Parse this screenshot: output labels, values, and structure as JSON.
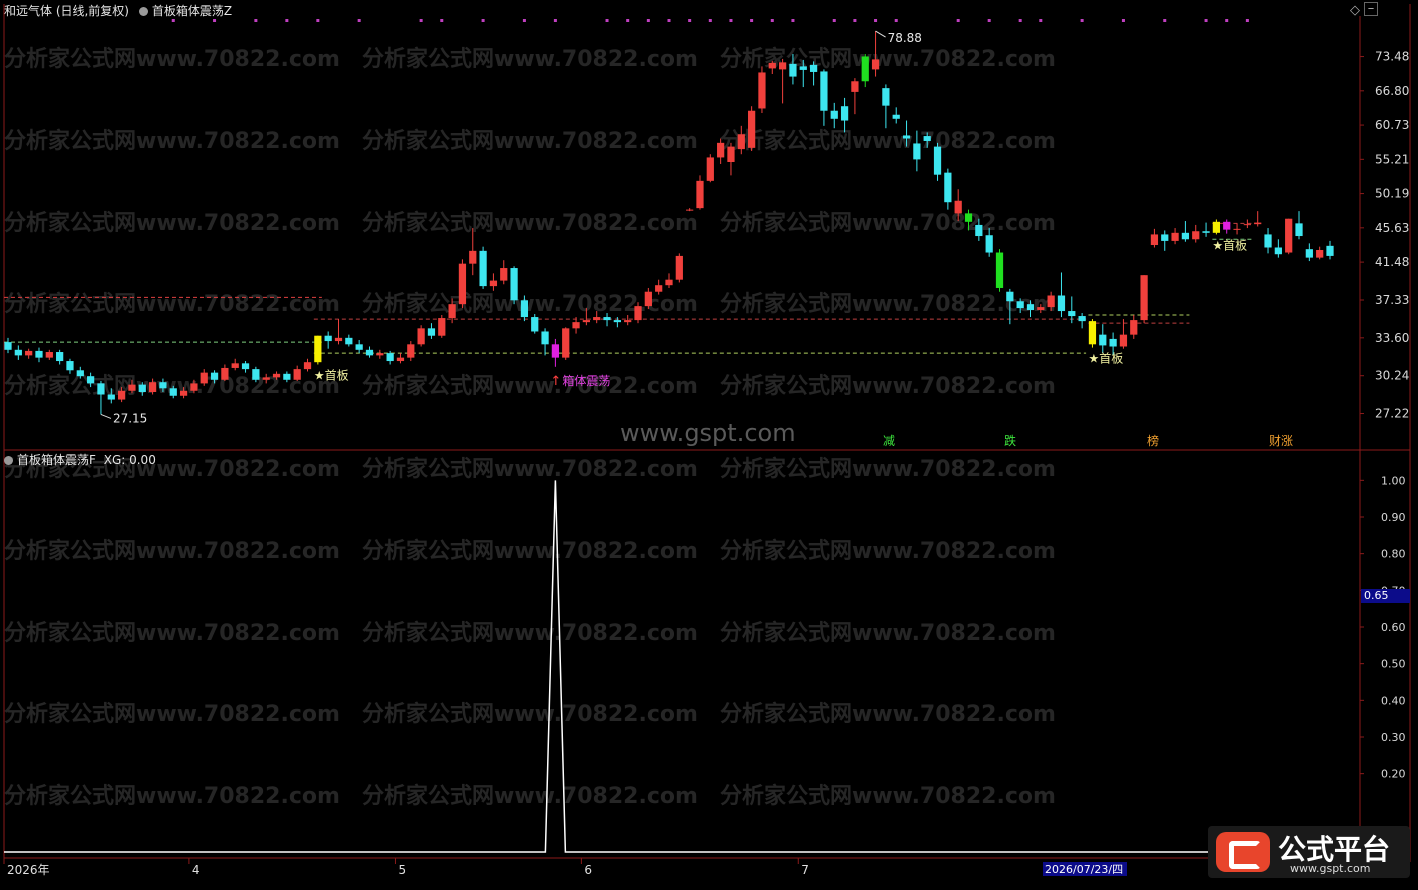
{
  "header": {
    "stock_title": "和远气体 (日线,前复权)",
    "indicator_main": "首板箱体震荡Z",
    "sub_title": "首板箱体震荡F",
    "sub_value": "XG: 0.00"
  },
  "watermarks": {
    "site": "www.gspt.com",
    "repeat": "分析家公式网www.70822.com"
  },
  "logo": {
    "text": "公式平台",
    "url": "www.gspt.com"
  },
  "colors": {
    "up": "#f0403c",
    "down": "#3de6f0",
    "bg": "#000000",
    "axis": "#8b1a1a"
  },
  "chart_data": [
    {
      "type": "candlestick",
      "title": "和远气体 (日线,前复权)",
      "y_axis_ticks": [
        "73.48",
        "66.80",
        "60.73",
        "55.21",
        "50.19",
        "45.63",
        "41.48",
        "37.33",
        "33.60",
        "30.24",
        "27.22"
      ],
      "ylim": [
        25.5,
        80
      ],
      "annotations": {
        "high_label": "78.88",
        "low_label": "27.15",
        "first_board": "★首板",
        "box_shake": "箱体震荡",
        "tags": [
          "减",
          "跌",
          "榜",
          "财涨"
        ]
      },
      "candles": [
        [
          33.2,
          32.5,
          33.6,
          32.2
        ],
        [
          32.5,
          32.0,
          32.9,
          31.6
        ],
        [
          32.0,
          32.4,
          32.6,
          31.7
        ],
        [
          32.4,
          31.8,
          32.7,
          31.4
        ],
        [
          31.8,
          32.3,
          32.5,
          31.6
        ],
        [
          32.3,
          31.5,
          32.5,
          31.2
        ],
        [
          31.5,
          30.7,
          31.7,
          30.4
        ],
        [
          30.7,
          30.2,
          31.0,
          30.0
        ],
        [
          30.2,
          29.6,
          30.5,
          29.3
        ],
        [
          29.6,
          28.7,
          29.8,
          27.15
        ],
        [
          28.7,
          28.3,
          29.2,
          28.0
        ],
        [
          28.3,
          29.0,
          29.3,
          28.1
        ],
        [
          29.0,
          29.5,
          29.9,
          28.8
        ],
        [
          29.5,
          28.9,
          29.7,
          28.6
        ],
        [
          28.9,
          29.7,
          30.0,
          28.7
        ],
        [
          29.7,
          29.2,
          30.0,
          28.9
        ],
        [
          29.2,
          28.6,
          29.4,
          28.4
        ],
        [
          28.6,
          29.0,
          29.3,
          28.4
        ],
        [
          29.0,
          29.6,
          29.9,
          28.8
        ],
        [
          29.6,
          30.5,
          30.8,
          29.4
        ],
        [
          30.5,
          29.9,
          30.7,
          29.6
        ],
        [
          29.9,
          30.9,
          31.2,
          29.8
        ],
        [
          30.9,
          31.3,
          31.7,
          30.7
        ],
        [
          31.3,
          30.8,
          31.5,
          30.5
        ],
        [
          30.8,
          29.9,
          31.0,
          29.7
        ],
        [
          29.9,
          30.1,
          30.4,
          29.6
        ],
        [
          30.1,
          30.4,
          30.6,
          29.9
        ],
        [
          30.4,
          29.9,
          30.6,
          29.7
        ],
        [
          29.9,
          30.8,
          31.1,
          29.8
        ],
        [
          30.8,
          31.4,
          31.7,
          30.6
        ],
        [
          31.4,
          33.8,
          33.8,
          31.2
        ],
        [
          33.8,
          33.3,
          34.2,
          32.6
        ],
        [
          33.3,
          33.6,
          35.4,
          33.0
        ],
        [
          33.6,
          33.0,
          33.9,
          32.8
        ],
        [
          33.0,
          32.5,
          33.4,
          32.2
        ],
        [
          32.5,
          32.0,
          32.8,
          31.8
        ],
        [
          32.0,
          32.2,
          32.5,
          31.7
        ],
        [
          32.2,
          31.5,
          32.4,
          31.2
        ],
        [
          31.5,
          31.8,
          32.2,
          31.3
        ],
        [
          31.8,
          33.0,
          33.3,
          31.5
        ],
        [
          33.0,
          34.5,
          34.8,
          32.8
        ],
        [
          34.5,
          33.8,
          35.0,
          33.5
        ],
        [
          33.8,
          35.5,
          35.8,
          33.6
        ],
        [
          35.5,
          36.9,
          37.5,
          35.0
        ],
        [
          36.9,
          41.3,
          41.8,
          36.5
        ],
        [
          41.3,
          42.8,
          45.6,
          40.0
        ],
        [
          42.8,
          38.8,
          43.3,
          38.5
        ],
        [
          38.8,
          39.4,
          40.2,
          38.3
        ],
        [
          39.4,
          40.8,
          41.7,
          39.0
        ],
        [
          40.8,
          37.3,
          41.0,
          36.9
        ],
        [
          37.3,
          35.6,
          37.8,
          35.2
        ],
        [
          35.6,
          34.2,
          35.9,
          34.0
        ],
        [
          34.2,
          33.0,
          34.5,
          32.0
        ],
        [
          33.0,
          31.8,
          33.5,
          31.0
        ],
        [
          31.8,
          34.5,
          34.6,
          31.6
        ],
        [
          34.5,
          35.1,
          35.6,
          34.0
        ],
        [
          35.1,
          35.3,
          36.5,
          34.8
        ],
        [
          35.3,
          35.6,
          36.2,
          35.0
        ],
        [
          35.6,
          35.3,
          36.0,
          34.7
        ],
        [
          35.3,
          35.1,
          35.6,
          34.6
        ],
        [
          35.1,
          35.3,
          35.8,
          34.8
        ],
        [
          35.3,
          36.7,
          37.1,
          35.0
        ],
        [
          36.7,
          38.2,
          38.6,
          36.4
        ],
        [
          38.2,
          38.9,
          39.5,
          37.9
        ],
        [
          38.9,
          39.5,
          40.2,
          38.6
        ],
        [
          39.5,
          42.2,
          42.5,
          39.2
        ],
        [
          48.0,
          48.0,
          48.2,
          47.8
        ],
        [
          48.2,
          52.0,
          52.8,
          48.0
        ],
        [
          52.0,
          55.5,
          56.0,
          51.8
        ],
        [
          55.5,
          57.8,
          58.5,
          54.5
        ],
        [
          54.8,
          57.2,
          57.8,
          52.8
        ],
        [
          56.8,
          59.2,
          60.6,
          56.0
        ],
        [
          57.0,
          63.2,
          64.0,
          56.5
        ],
        [
          63.6,
          70.3,
          71.5,
          62.8
        ],
        [
          71.1,
          72.2,
          72.6,
          70.0
        ],
        [
          70.9,
          72.3,
          73.0,
          64.5
        ],
        [
          72.0,
          69.5,
          74.0,
          68.0
        ],
        [
          71.5,
          70.8,
          72.8,
          67.5
        ],
        [
          71.8,
          70.4,
          72.5,
          67.8
        ],
        [
          70.5,
          63.2,
          70.9,
          60.6
        ],
        [
          63.2,
          61.8,
          64.6,
          60.2
        ],
        [
          64.0,
          61.5,
          65.5,
          59.5
        ],
        [
          66.6,
          68.6,
          69.2,
          62.6
        ],
        [
          68.6,
          73.5,
          74.0,
          67.5
        ],
        [
          70.9,
          72.9,
          78.88,
          69.5
        ],
        [
          67.3,
          64.1,
          68.0,
          60.2
        ],
        [
          62.5,
          61.8,
          63.8,
          61.0
        ],
        [
          59.0,
          58.5,
          61.5,
          57.2
        ],
        [
          57.7,
          55.2,
          59.8,
          53.4
        ],
        [
          58.9,
          58.1,
          59.5,
          57.0
        ],
        [
          57.2,
          52.9,
          57.8,
          52.0
        ],
        [
          53.2,
          49.0,
          53.8,
          48.0
        ],
        [
          47.5,
          49.2,
          50.8,
          46.5
        ],
        [
          47.5,
          46.4,
          48.0,
          45.3
        ],
        [
          46.0,
          44.6,
          46.8,
          44.0
        ],
        [
          44.7,
          42.6,
          45.6,
          42.1
        ],
        [
          42.6,
          38.6,
          43.0,
          38.2
        ],
        [
          38.2,
          37.2,
          38.5,
          34.9
        ],
        [
          37.2,
          36.5,
          37.5,
          36.0
        ],
        [
          36.9,
          36.3,
          37.3,
          35.6
        ],
        [
          36.3,
          36.6,
          36.9,
          36.0
        ],
        [
          36.6,
          37.8,
          38.2,
          36.2
        ],
        [
          37.8,
          36.2,
          40.3,
          35.6
        ],
        [
          36.2,
          35.7,
          37.7,
          35.0
        ],
        [
          35.7,
          35.2,
          36.0,
          34.5
        ],
        [
          35.2,
          33.0,
          35.4,
          32.7
        ],
        [
          33.9,
          32.9,
          34.9,
          32.2
        ],
        [
          33.5,
          32.8,
          34.1,
          32.0
        ],
        [
          32.8,
          33.9,
          35.4,
          32.6
        ],
        [
          33.9,
          35.3,
          35.8,
          33.5
        ],
        [
          35.3,
          40.0,
          40.0,
          35.0
        ],
        [
          43.5,
          44.8,
          45.5,
          43.2
        ],
        [
          44.8,
          44.0,
          45.3,
          42.8
        ],
        [
          44.0,
          45.0,
          45.6,
          43.6
        ],
        [
          45.0,
          44.2,
          46.5,
          43.9
        ],
        [
          44.2,
          45.2,
          46.0,
          43.8
        ],
        [
          45.2,
          45.0,
          46.3,
          44.5
        ],
        [
          45.0,
          46.4,
          46.7,
          44.8
        ],
        [
          46.4,
          45.4,
          46.7,
          44.9
        ],
        [
          45.4,
          45.5,
          46.2,
          44.8
        ],
        [
          46.0,
          46.1,
          46.7,
          45.6
        ],
        [
          46.1,
          46.3,
          47.8,
          45.8
        ],
        [
          44.8,
          43.2,
          45.6,
          42.5
        ],
        [
          43.2,
          42.4,
          44.2,
          42.0
        ],
        [
          42.6,
          46.8,
          46.8,
          42.4
        ],
        [
          46.2,
          44.6,
          47.8,
          44.2
        ],
        [
          43.0,
          42.0,
          43.7,
          41.6
        ],
        [
          42.0,
          42.9,
          43.3,
          41.8
        ],
        [
          43.4,
          42.2,
          44.0,
          41.8
        ]
      ],
      "bar_colors": {
        "30": "yellow",
        "53": "magenta",
        "105": "yellow",
        "117": "yellow",
        "118": "magenta",
        "93": "green",
        "83": "green",
        "96": "green"
      },
      "markers": {
        "first_board_bars": [
          30,
          105,
          117
        ],
        "box_shake_bar": 53,
        "high_bar": 84,
        "low_bar": 9
      },
      "h_lines": [
        {
          "y": 37.6,
          "x_from": 0,
          "x_to": 30,
          "color": "#e04040"
        },
        {
          "y": 33.2,
          "x_from": 0,
          "x_to": 30,
          "color": "#7fd07f"
        },
        {
          "y": 35.4,
          "x_from": 30,
          "x_to": 104,
          "color": "#c04040"
        },
        {
          "y": 32.2,
          "x_from": 30,
          "x_to": 104,
          "color": "#b0d060"
        },
        {
          "y": 35.8,
          "x_from": 105,
          "x_to": 114,
          "color": "#b0d060"
        },
        {
          "y": 35.0,
          "x_from": 105,
          "x_to": 114,
          "color": "#c04040"
        },
        {
          "y": 46.2,
          "x_from": 117,
          "x_to": 120,
          "color": "#c04040"
        },
        {
          "y": 44.2,
          "x_from": 117,
          "x_to": 120,
          "color": "#7fd07f"
        }
      ],
      "top_dots": [
        16,
        20,
        24,
        27,
        30,
        34,
        40,
        42,
        46,
        50,
        53,
        58,
        60,
        62,
        64,
        66,
        68,
        70,
        72,
        74,
        76,
        80,
        82,
        84,
        86,
        92,
        95,
        98,
        100,
        104,
        108,
        112,
        116,
        118,
        120
      ]
    },
    {
      "type": "line",
      "title": "首板箱体震荡F",
      "y_axis_ticks": [
        "1.00",
        "0.90",
        "0.80",
        "0.70",
        "0.60",
        "0.50",
        "0.40",
        "0.30",
        "0.20"
      ],
      "ylim": [
        0,
        1.05
      ],
      "current_value_tag": "0.65",
      "spike_bar": 53,
      "spike_value": 1.0
    }
  ],
  "x_axis": {
    "labels": [
      "2026年",
      "4",
      "5",
      "6",
      "7"
    ],
    "label_bars": [
      0,
      18,
      38,
      56,
      77
    ],
    "cursor_date": "2026/07/23/四"
  }
}
